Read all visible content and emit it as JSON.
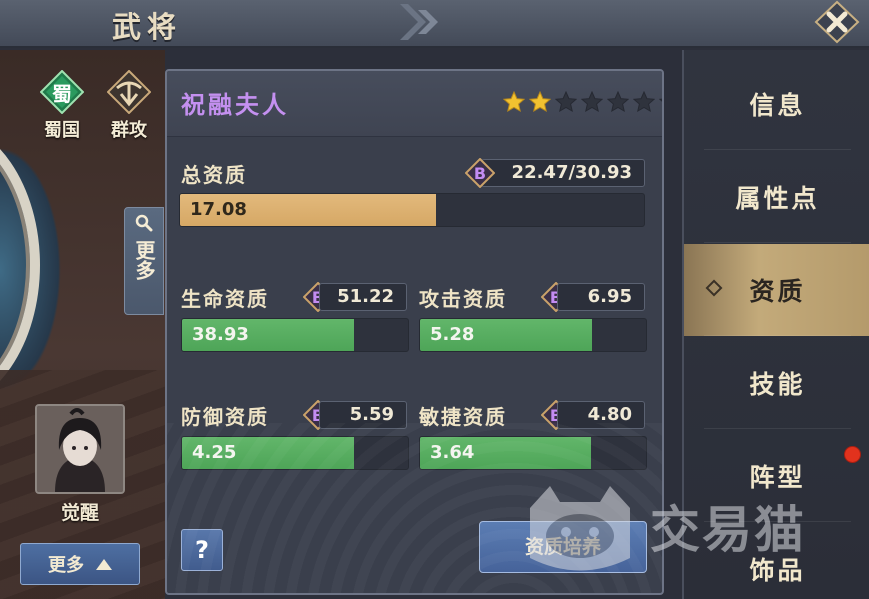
{
  "header": {
    "title": "武将"
  },
  "left": {
    "factions": [
      {
        "glyph": "蜀",
        "label": "蜀国",
        "icon": "shu-emblem-icon"
      },
      {
        "glyph": "",
        "label": "群攻",
        "icon": "aoe-attack-icon"
      }
    ],
    "more_side_label": "更多",
    "avatar_label": "觉醒",
    "more_button_label": "更多"
  },
  "panel": {
    "hero_name": "祝融夫人",
    "stars": {
      "filled": 2,
      "total": 7
    },
    "total": {
      "label": "总资质",
      "grade": "B",
      "value_text": "22.47/30.93",
      "current": 17.08,
      "current_text": "17.08",
      "max": 30.93
    },
    "stats": [
      {
        "label": "生命资质",
        "grade": "B",
        "max_text": "51.22",
        "current_text": "38.93",
        "current": 38.93,
        "max": 51.22
      },
      {
        "label": "攻击资质",
        "grade": "B",
        "max_text": "6.95",
        "current_text": "5.28",
        "current": 5.28,
        "max": 6.95
      },
      {
        "label": "防御资质",
        "grade": "B",
        "max_text": "5.59",
        "current_text": "4.25",
        "current": 4.25,
        "max": 5.59
      },
      {
        "label": "敏捷资质",
        "grade": "B",
        "max_text": "4.80",
        "current_text": "3.64",
        "current": 3.64,
        "max": 4.8
      }
    ],
    "help_label": "?",
    "cultivate_label": "资质培养"
  },
  "tabs": [
    {
      "label": "信息",
      "active": false
    },
    {
      "label": "属性点",
      "active": false
    },
    {
      "label": "资质",
      "active": true
    },
    {
      "label": "技能",
      "active": false
    },
    {
      "label": "阵型",
      "active": false,
      "badge": true
    },
    {
      "label": "饰品",
      "active": false
    }
  ],
  "watermark": "交易猫",
  "colors": {
    "hero_name": "#c490f0",
    "gold_bar": "#d6a865",
    "green_bar": "#4ea558",
    "active_tab": "#c3aa7a",
    "badge": "#e2321d"
  }
}
